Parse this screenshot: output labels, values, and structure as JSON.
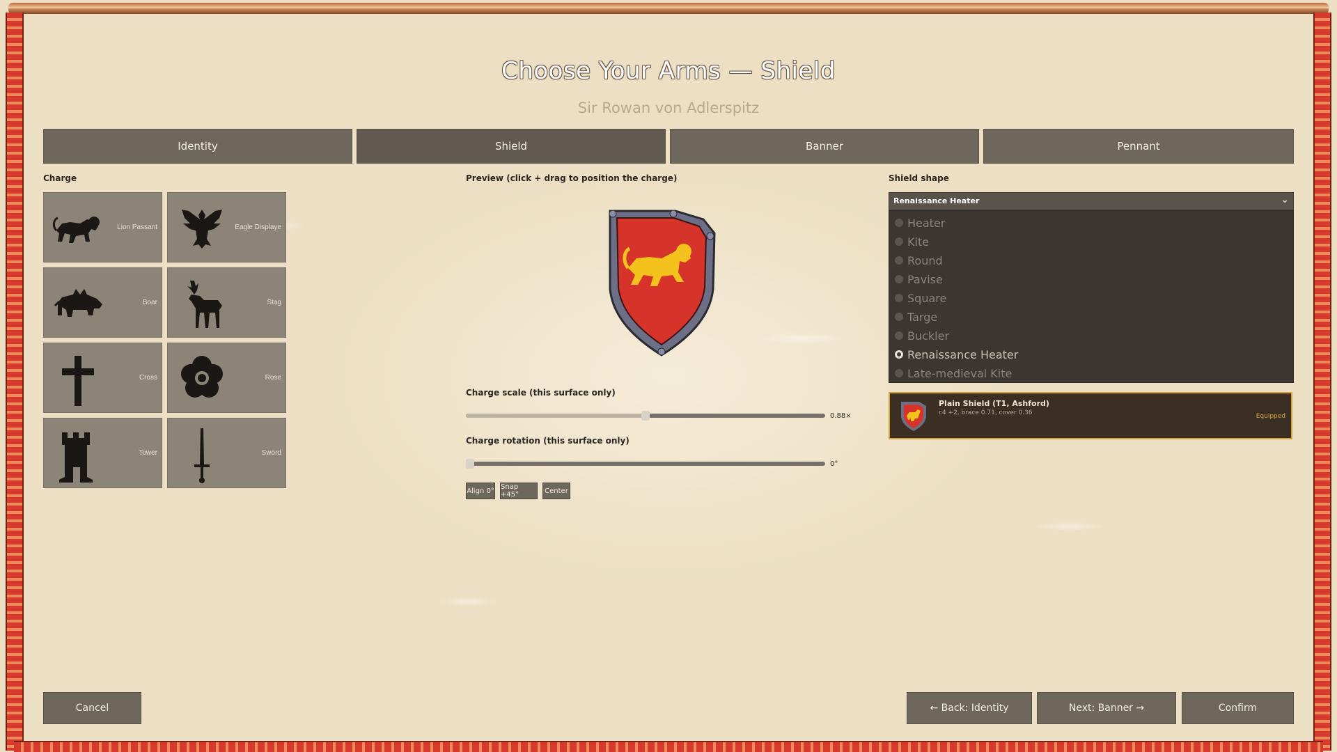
{
  "header": {
    "title": "Choose Your Arms — Shield",
    "subtitle": "Sir Rowan von Adlerspitz"
  },
  "tabs": [
    {
      "label": "Identity"
    },
    {
      "label": "Shield"
    },
    {
      "label": "Banner"
    },
    {
      "label": "Pennant"
    }
  ],
  "charge": {
    "section_label": "Charge",
    "items": [
      {
        "label": "Lion Passant",
        "icon": "lion-icon"
      },
      {
        "label": "Eagle Displaye",
        "icon": "eagle-icon"
      },
      {
        "label": "Boar",
        "icon": "boar-icon"
      },
      {
        "label": "Stag",
        "icon": "stag-icon"
      },
      {
        "label": "Cross",
        "icon": "cross-icon"
      },
      {
        "label": "Rose",
        "icon": "rose-icon"
      },
      {
        "label": "Tower",
        "icon": "tower-icon"
      },
      {
        "label": "Sword",
        "icon": "sword-icon"
      }
    ]
  },
  "preview": {
    "label": "Preview  (click + drag to position the charge)",
    "field_color": "#d6332a",
    "charge_color": "#f3c21d",
    "rim_color": "#6c6f85"
  },
  "controls": {
    "scale_label": "Charge scale (this surface only)",
    "scale_value_text": "0.88×",
    "scale_fraction": 0.5,
    "rotation_label": "Charge rotation (this surface only)",
    "rotation_value_text": "0°",
    "rotation_fraction": 0.0,
    "buttons": [
      "Align 0°",
      "Snap +45°",
      "Center"
    ]
  },
  "shape": {
    "section_label": "Shield shape",
    "selected": "Renaissance Heater",
    "options": [
      "Heater",
      "Kite",
      "Round",
      "Pavise",
      "Square",
      "Targe",
      "Buckler",
      "Renaissance Heater",
      "Late-medieval Kite"
    ],
    "selected_index": 7
  },
  "equipped": {
    "name": "Plain Shield  (T1, Ashford)",
    "stats": "c4 +2, brace 0.71, cover 0.36",
    "status": "Equipped",
    "border_color": "#d4a13a"
  },
  "footer": {
    "cancel": "Cancel",
    "back": "← Back: Identity",
    "next": "Next: Banner →",
    "confirm": "Confirm"
  }
}
